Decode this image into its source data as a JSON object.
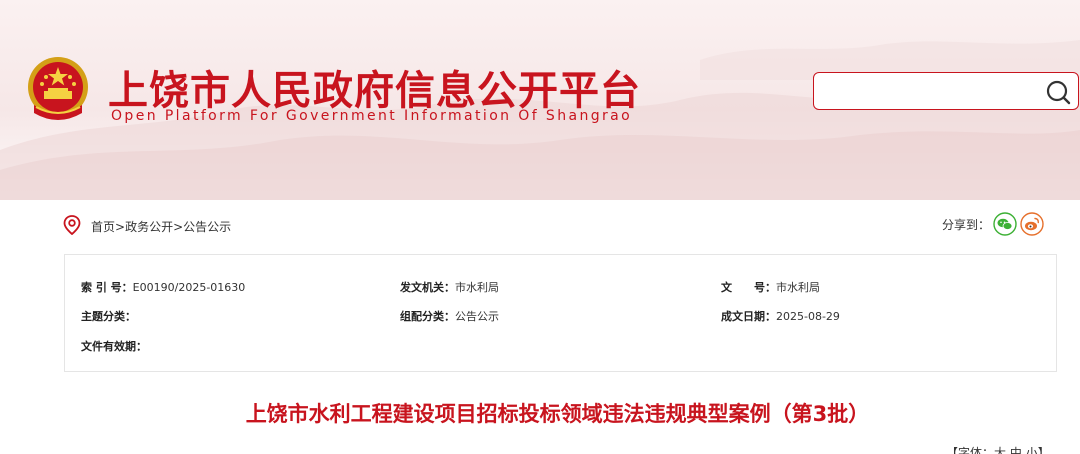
{
  "site": {
    "title": "上饶市人民政府信息公开平台",
    "subtitle": "Open Platform For Government Information Of Shangrao"
  },
  "search": {
    "placeholder": "",
    "value": ""
  },
  "breadcrumb": {
    "items": [
      "首页",
      "政务公开",
      "公告公示"
    ],
    "separator": ">"
  },
  "share": {
    "label": "分享到：",
    "icons": [
      "wechat-icon",
      "weibo-icon"
    ]
  },
  "info": {
    "index_no_label": "索 引 号：",
    "index_no": "E00190/2025-01630",
    "issuer_label": "发文机关：",
    "issuer": "市水利局",
    "doc_no_label": "文　　号：",
    "doc_no": "市水利局",
    "topic_label": "主题分类：",
    "topic": "",
    "category_label": "组配分类：",
    "category": "公告公示",
    "date_label": "成文日期：",
    "date": "2025-08-29",
    "validity_label": "文件有效期：",
    "validity": ""
  },
  "article": {
    "title": "上饶市水利工程建设项目招标投标领域违法违规典型案例（第3批）"
  },
  "font_size": {
    "prefix": "【字体：",
    "large": "大",
    "medium": "中",
    "small": "小",
    "suffix": "】"
  },
  "colors": {
    "brand_red": "#c8141e",
    "wechat_green": "#3cb034",
    "weibo_orange": "#e6702c"
  }
}
